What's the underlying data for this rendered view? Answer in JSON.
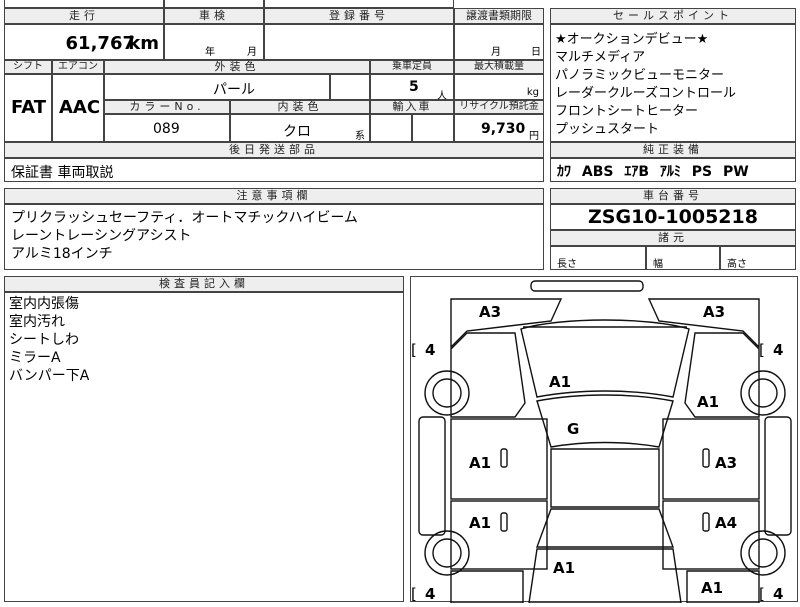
{
  "labels": {
    "mileage": "走行",
    "inspection": "車検",
    "registration": "登録番号",
    "transfer_deadline": "譲渡書類期限",
    "shift": "シフト",
    "aircon": "エアコン",
    "exterior_color": "外装色",
    "capacity": "乗車定員",
    "max_load": "最大積載量",
    "color_no": "カラーNo.",
    "interior_color": "内装色",
    "import": "輸入車",
    "recycle": "リサイクル預託金",
    "later_parts": "後日発送部品",
    "notes": "注意事項欄",
    "inspector": "検査員記入欄",
    "sales_points": "セールスポイント",
    "genuine_equipment": "純正装備",
    "chassis_no": "車台番号",
    "dimensions": "諸元",
    "length": "長さ",
    "width": "幅",
    "height": "高さ",
    "year": "年",
    "month": "月",
    "day": "日",
    "persons_unit": "人",
    "kg_unit": "kg",
    "yen_unit": "円",
    "series_suffix": "系"
  },
  "values": {
    "mileage": "61,767",
    "mileage_unit": "km",
    "shift": "FAT",
    "aircon": "AAC",
    "exterior_color": "パール",
    "capacity": "5",
    "color_no": "089",
    "interior_color": "クロ",
    "recycle": "9,730"
  },
  "later_parts_text": "保証書 車両取説",
  "notes_lines": [
    "プリクラッシュセーフティ．オートマチックハイビーム",
    "レーントレーシングアシスト",
    "アルミ18インチ"
  ],
  "inspector_lines": [
    "室内内張傷",
    "室内汚れ",
    "シートしわ",
    "ミラーA",
    "バンパー下A"
  ],
  "sales_points": [
    "★オークションデビュー★",
    "マルチメディア",
    "パノラミックビューモニター",
    "レーダークルーズコントロール",
    "フロントシートヒーター",
    "プッシュスタート"
  ],
  "equipment": [
    "ｶﾜ",
    "ABS",
    "ｴｱB",
    "ｱﾙﾐ",
    "PS",
    "PW"
  ],
  "chassis_no": "ZSG10-1005218",
  "diagram": {
    "top_left": "A3",
    "top_right": "A3",
    "hood": "A1",
    "front_right_fender": "A1",
    "windshield": "G",
    "left_front_door": "A1",
    "left_rear_door": "A1",
    "right_front_door": "A3",
    "right_rear_door": "A4",
    "rear": "A1",
    "rear_right": "A1",
    "tire_top_left": "4",
    "tire_top_right": "4",
    "tire_bottom_left": "4",
    "tire_bottom_right": "4"
  }
}
